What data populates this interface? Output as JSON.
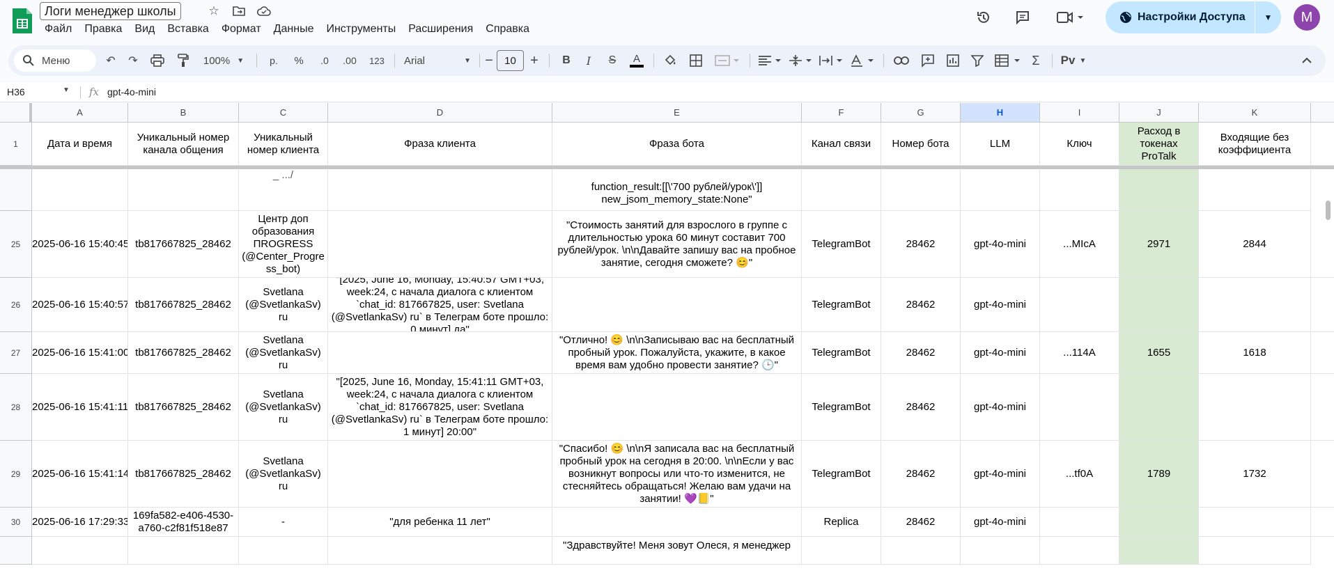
{
  "app": {
    "title": "Логи менеджер школы",
    "avatar_letter": "M",
    "share_label": "Настройки Доступа",
    "accent": "#c2e7ff"
  },
  "menu": [
    "Файл",
    "Правка",
    "Вид",
    "Вставка",
    "Формат",
    "Данные",
    "Инструменты",
    "Расширения",
    "Справка"
  ],
  "toolbar": {
    "search_label": "Меню",
    "zoom": "100%",
    "currency": "р.",
    "percent": "%",
    "dec_decrease": ".0",
    "dec_increase": ".00",
    "number_format": "123",
    "font": "Arial",
    "font_size": "10"
  },
  "formula_bar": {
    "cell_ref": "H36",
    "value": "gpt-4o-mini"
  },
  "columns": [
    "A",
    "B",
    "C",
    "D",
    "E",
    "F",
    "G",
    "H",
    "I",
    "J",
    "K"
  ],
  "header_row": {
    "row_num": "1",
    "cells": [
      "Дата и время",
      "Уникальный номер канала общения",
      "Уникальный номер клиента",
      "Фраза клиента",
      "Фраза бота",
      "Канал связи",
      "Номер бота",
      "LLM",
      "Ключ",
      "Расход в токенах ProTalk",
      "Входящие без коэффициента"
    ]
  },
  "partial_top_row": {
    "c": "_ .../",
    "e": "function_result:[[\\'700 рублей/урок\\']]\nnew_jsom_memory_state:None\""
  },
  "rows": [
    {
      "num": "25",
      "a": "2025-06-16 15:40:45",
      "b": "tb817667825_28462",
      "c": "Центр доп образования ПROGRESS (@Center_Progress_bot)",
      "d": "",
      "e": "\"Стоимость занятий для взрослого в группе с длительностью урока 60 минут составит 700 рублей/урок. \\n\\nДавайте запишу вас на пробное занятие, сегодня сможете? 😊\"",
      "f": "TelegramBot",
      "g": "28462",
      "h": "gpt-4o-mini",
      "i": "...MIcA",
      "j": "2971",
      "k": "2844"
    },
    {
      "num": "26",
      "a": "2025-06-16 15:40:57",
      "b": "tb817667825_28462",
      "c": "Svetlana (@SvetlankaSv) ru",
      "d": "\"[2025, June 16, Monday, 15:40:57 GMT+03, week:24, с начала диалога с клиентом `chat_id: 817667825, user: Svetlana (@SvetlankaSv) ru` в Телеграм боте прошло: 0 минут] да\"",
      "e": "",
      "f": "TelegramBot",
      "g": "28462",
      "h": "gpt-4o-mini",
      "i": "",
      "j": "",
      "k": ""
    },
    {
      "num": "27",
      "a": "2025-06-16 15:41:00",
      "b": "tb817667825_28462",
      "c": "Svetlana (@SvetlankaSv) ru",
      "d": "",
      "e": "\"Отлично! 😊 \\n\\nЗаписываю вас на бесплатный пробный урок. Пожалуйста, укажите, в какое время вам удобно провести занятие? 🕒\"",
      "f": "TelegramBot",
      "g": "28462",
      "h": "gpt-4o-mini",
      "i": "...114A",
      "j": "1655",
      "k": "1618"
    },
    {
      "num": "28",
      "a": "2025-06-16 15:41:11",
      "b": "tb817667825_28462",
      "c": "Svetlana (@SvetlankaSv) ru",
      "d": "\"[2025, June 16, Monday, 15:41:11 GMT+03, week:24, с начала диалога с клиентом `chat_id: 817667825, user: Svetlana (@SvetlankaSv) ru` в Телеграм боте прошло: 1 минут] 20:00\"",
      "e": "",
      "f": "TelegramBot",
      "g": "28462",
      "h": "gpt-4o-mini",
      "i": "",
      "j": "",
      "k": ""
    },
    {
      "num": "29",
      "a": "2025-06-16 15:41:14",
      "b": "tb817667825_28462",
      "c": "Svetlana (@SvetlankaSv) ru",
      "d": "",
      "e": "\"Спасибо! 😊 \\n\\nЯ записала вас на бесплатный пробный урок на сегодня в 20:00. \\n\\nЕсли у вас возникнут вопросы или что-то изменится, не стесняйтесь обращаться! Желаю вам удачи на занятии! 💜📒\"",
      "f": "TelegramBot",
      "g": "28462",
      "h": "gpt-4o-mini",
      "i": "...tf0A",
      "j": "1789",
      "k": "1732"
    },
    {
      "num": "30",
      "a": "2025-06-16 17:29:33",
      "b": "169fa582-e406-4530-a760-c2f81f518e87",
      "c": "-",
      "d": "\"для ребенка 11 лет\"",
      "e": "",
      "f": "Replica",
      "g": "28462",
      "h": "gpt-4o-mini",
      "i": "",
      "j": "",
      "k": ""
    }
  ],
  "partial_bottom_row": {
    "e": "\"Здравствуйте! Меня зовут Олеся, я менеджер"
  },
  "icons": [
    "sheets-logo-icon",
    "star-icon",
    "move-folder-icon",
    "cloud-status-icon",
    "history-icon",
    "comment-icon",
    "meet-icon",
    "globe-icon",
    "search-icon",
    "undo-icon",
    "redo-icon",
    "print-icon",
    "paint-format-icon"
  ]
}
